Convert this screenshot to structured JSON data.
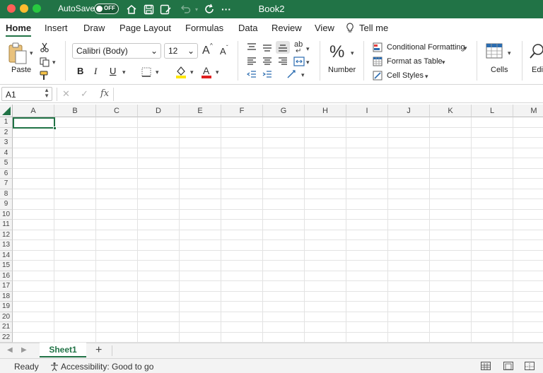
{
  "titlebar": {
    "autosave_label": "AutoSave",
    "autosave_state": "OFF",
    "doc_title": "Book2",
    "more": "···"
  },
  "tabs": [
    "Home",
    "Insert",
    "Draw",
    "Page Layout",
    "Formulas",
    "Data",
    "Review",
    "View",
    "Tell me"
  ],
  "ribbon": {
    "paste_label": "Paste",
    "font_name": "Calibri (Body)",
    "font_size": "12",
    "grow_font": "A",
    "shrink_font": "A",
    "bold": "B",
    "italic": "I",
    "underline": "U",
    "font_color_letter": "A",
    "number_label": "Number",
    "number_symbol": "%",
    "conditional_formatting": "Conditional Formatting",
    "format_as_table": "Format as Table",
    "cell_styles": "Cell Styles",
    "cells_label": "Cells",
    "editing_label": "Edit",
    "wrap_label": "ab",
    "colors": {
      "accent": "#217346",
      "fill_highlight": "#ffe600",
      "font_color_bar": "#e02020"
    }
  },
  "formula_bar": {
    "name_box": "A1",
    "cancel": "✕",
    "enter": "✓",
    "fx": "fx",
    "formula": ""
  },
  "grid": {
    "columns": [
      "A",
      "B",
      "C",
      "D",
      "E",
      "F",
      "G",
      "H",
      "I",
      "J",
      "K",
      "L",
      "M"
    ],
    "rows": [
      "1",
      "2",
      "3",
      "4",
      "5",
      "6",
      "7",
      "8",
      "9",
      "10",
      "11",
      "12",
      "13",
      "14",
      "15",
      "16",
      "17",
      "18",
      "19",
      "20",
      "21",
      "22"
    ],
    "active_cell": "A1"
  },
  "sheets": {
    "tabs": [
      "Sheet1"
    ],
    "add": "+",
    "prev": "◀",
    "next": "▶"
  },
  "status": {
    "ready": "Ready",
    "accessibility": "Accessibility: Good to go"
  }
}
